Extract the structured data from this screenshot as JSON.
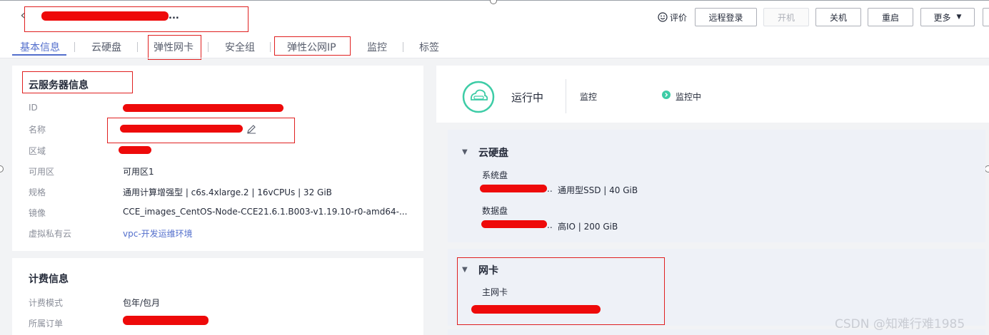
{
  "header": {
    "title": "...",
    "rate_label": "评价",
    "buttons": {
      "remote_login": "远程登录",
      "power_on": "开机",
      "shutdown": "关机",
      "restart": "重启",
      "more": "更多"
    }
  },
  "tabs": [
    "基本信息",
    "云硬盘",
    "弹性网卡",
    "安全组",
    "弹性公网IP",
    "监控",
    "标签"
  ],
  "server_info": {
    "title": "云服务器信息",
    "rows": [
      {
        "label": "ID",
        "value": ""
      },
      {
        "label": "名称",
        "value": ""
      },
      {
        "label": "区域",
        "value": ""
      },
      {
        "label": "可用区",
        "value": "可用区1"
      },
      {
        "label": "规格",
        "value": "通用计算增强型 | c6s.4xlarge.2 | 16vCPUs | 32 GiB"
      },
      {
        "label": "镜像",
        "value": "CCE_images_CentOS-Node-CCE21.6.1.B003-v1.19.10-r0-amd64-..."
      },
      {
        "label": "虚拟私有云",
        "value": "vpc-开发运维环境"
      }
    ]
  },
  "billing_info": {
    "title": "计费信息",
    "rows": [
      {
        "label": "计费模式",
        "value": "包年/包月"
      },
      {
        "label": "所属订单",
        "value": ""
      }
    ]
  },
  "status": {
    "state": "运行中",
    "monitor_label": "监控",
    "monitor_value": "监控中"
  },
  "disks": {
    "title": "云硬盘",
    "system_label": "系统盘",
    "system_suffix": "..",
    "system_value": "通用型SSD  |  40 GiB",
    "data_label": "数据盘",
    "data_suffix": "..",
    "data_value": "高IO  |  200 GiB"
  },
  "nic": {
    "title": "网卡",
    "primary_label": "主网卡"
  },
  "watermark": "CSDN @知难行难1985",
  "colors": {
    "accent": "#526ecc",
    "annotation_red": "#e02020",
    "status_green": "#3dcca6"
  }
}
